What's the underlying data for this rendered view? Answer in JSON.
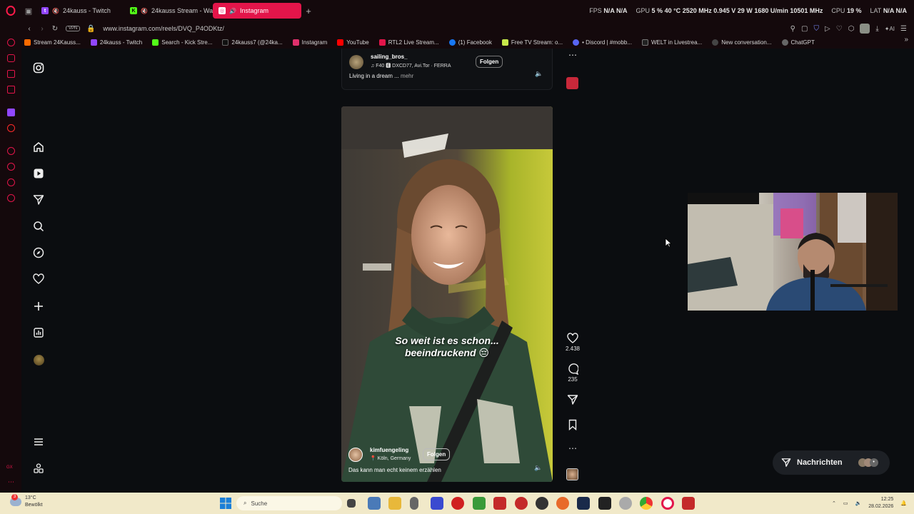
{
  "tabs": [
    {
      "label": "24kauss - Twitch",
      "color": "#9146ff",
      "glyph": "t"
    },
    {
      "label": "24kauss Stream - Wa",
      "color": "#53fc18",
      "glyph": "K"
    },
    {
      "label": "Instagram",
      "color": "#e1306c",
      "glyph": "◎",
      "active": true
    }
  ],
  "stats": {
    "fps_label": "FPS",
    "fps": "N/A",
    "fps2": "N/A",
    "gpu_label": "GPU",
    "gpu_load": "5 %",
    "gpu_temp": "40 °C",
    "gpu_clock": "2520 MHz",
    "gpu_volt": "0.945 V",
    "gpu_power": "29 W",
    "gpu_fan": "1680 U/min",
    "gpu_mem": "10501 MHz",
    "cpu_label": "CPU",
    "cpu_load": "19 %",
    "lat_label": "LAT",
    "lat": "N/A",
    "lat2": "N/A"
  },
  "address": {
    "url": "www.instagram.com/reels/DVQ_P4ODKtz/",
    "vpn": "VPN"
  },
  "bookmarks": [
    {
      "label": "Stream 24Kauss...",
      "color": "#ff6a00"
    },
    {
      "label": "24kauss - Twitch",
      "color": "#9146ff"
    },
    {
      "label": "Search - Kick Stre...",
      "color": "#53fc18"
    },
    {
      "label": "24kauss7 (@24ka...",
      "color": "#111111"
    },
    {
      "label": "Instagram",
      "color": "#e1306c"
    },
    {
      "label": "YouTube",
      "color": "#ff0000"
    },
    {
      "label": "RTL2 Live Stream...",
      "color": "#e3154a"
    },
    {
      "label": "(1) Facebook",
      "color": "#1877f2"
    },
    {
      "label": "Free TV Stream: o...",
      "color": "#c7e84a"
    },
    {
      "label": "• Discord | #mobb...",
      "color": "#5865f2"
    },
    {
      "label": "WELT in Livestrea...",
      "color": "#222222"
    },
    {
      "label": "New conversation...",
      "color": "#444444"
    },
    {
      "label": "ChatGPT",
      "color": "#666666"
    }
  ],
  "prev_post": {
    "username": "sailing_bros_",
    "audio": "F40 🅴  DXCD77, Avi.Tor · FERRA",
    "follow": "Folgen",
    "caption": "Living in a dream ...",
    "more": "mehr"
  },
  "reel": {
    "overlay_line1": "So weit ist es schon...",
    "overlay_line2": "beeindruckend 😔",
    "username": "kimfuengeling",
    "location": "Köln, Germany",
    "follow": "Folgen",
    "caption": "Das kann man echt keinem erzählen",
    "likes": "2.438",
    "comments": "235"
  },
  "messages_label": "Nachrichten",
  "taskbar": {
    "weather_temp": "13°C",
    "weather_text": "Bewölkt",
    "search_placeholder": "Suche",
    "time": "12:25",
    "date": "28.02.2026",
    "notif_count": "3"
  },
  "colors": {
    "accent": "#e3154a",
    "tabbar": "#14090c",
    "taskbar": "#f1e9c9"
  }
}
